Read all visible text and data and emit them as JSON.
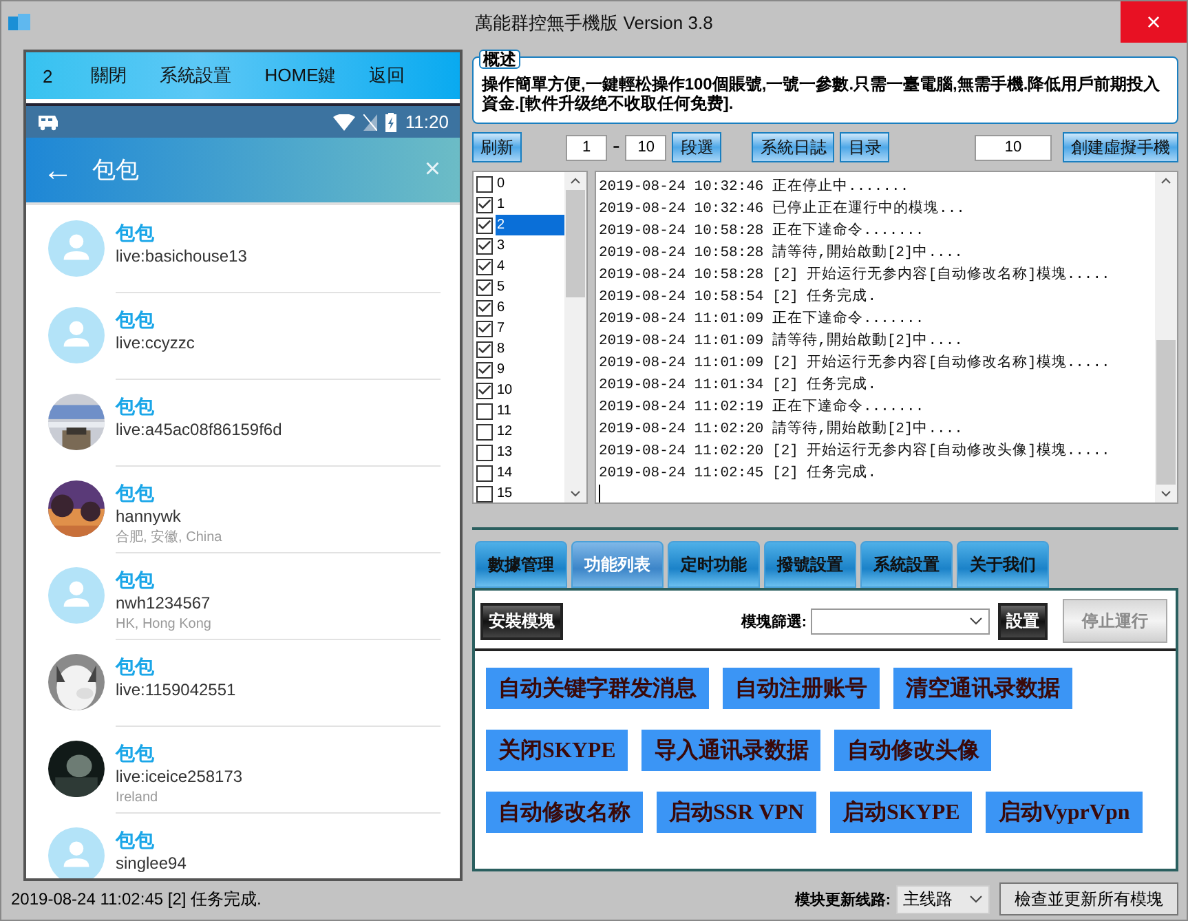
{
  "window": {
    "title": "萬能群控無手機版 Version 3.8",
    "close": "×"
  },
  "phone": {
    "toolbar": [
      "2",
      "關閉",
      "系統設置",
      "HOME鍵",
      "返回"
    ],
    "status_time": "11:20",
    "search": {
      "back": "←",
      "value": "包包",
      "clear": "×"
    },
    "contacts": [
      {
        "name": "包包",
        "id": "live:basichouse13",
        "kind": "default"
      },
      {
        "name": "包包",
        "id": "live:ccyzzc",
        "kind": "default"
      },
      {
        "name": "包包",
        "id": "live:a45ac08f86159f6d",
        "kind": "picture"
      },
      {
        "name": "包包",
        "id": "hannywk",
        "location": "合肥, 安徽, China",
        "kind": "picture"
      },
      {
        "name": "包包",
        "id": "nwh1234567",
        "location": "HK, Hong Kong",
        "kind": "default"
      },
      {
        "name": "包包",
        "id": "live:1159042551",
        "kind": "picture"
      },
      {
        "name": "包包",
        "id": "live:iceice258173",
        "location": "Ireland",
        "kind": "picture"
      },
      {
        "name": "包包",
        "id": "singlee94",
        "kind": "default"
      }
    ]
  },
  "overview": {
    "legend": "概述",
    "text": "操作簡單方便,一鍵輕松操作100個賬號,一號一參數.只需一臺電腦,無需手機.降低用戶前期投入資金.[軟件升级绝不收取任何免费]."
  },
  "toolbar": {
    "refresh": "刷新",
    "range_from": "1",
    "range_sep": "-",
    "range_to": "10",
    "select": "段選",
    "log": "系統日誌",
    "catalog": "目录",
    "count": "10",
    "create": "創建虛擬手機"
  },
  "devices": [
    {
      "label": "0",
      "checked": false,
      "selected": false
    },
    {
      "label": "1",
      "checked": true,
      "selected": false
    },
    {
      "label": "2",
      "checked": true,
      "selected": true
    },
    {
      "label": "3",
      "checked": true,
      "selected": false
    },
    {
      "label": "4",
      "checked": true,
      "selected": false
    },
    {
      "label": "5",
      "checked": true,
      "selected": false
    },
    {
      "label": "6",
      "checked": true,
      "selected": false
    },
    {
      "label": "7",
      "checked": true,
      "selected": false
    },
    {
      "label": "8",
      "checked": true,
      "selected": false
    },
    {
      "label": "9",
      "checked": true,
      "selected": false
    },
    {
      "label": "10",
      "checked": true,
      "selected": false
    },
    {
      "label": "11",
      "checked": false,
      "selected": false
    },
    {
      "label": "12",
      "checked": false,
      "selected": false
    },
    {
      "label": "13",
      "checked": false,
      "selected": false
    },
    {
      "label": "14",
      "checked": false,
      "selected": false
    },
    {
      "label": "15",
      "checked": false,
      "selected": false
    }
  ],
  "log": [
    "2019-08-24 10:32:46 正在停止中.......",
    "2019-08-24 10:32:46 已停止正在運行中的模塊...",
    "2019-08-24 10:58:28 正在下達命令.......",
    "2019-08-24 10:58:28 請等待,開始啟動[2]中....",
    "2019-08-24 10:58:28 [2] 开始运行无参内容[自动修改名称]模塊.....",
    "2019-08-24 10:58:54 [2] 任务完成.",
    "2019-08-24 11:01:09 正在下達命令.......",
    "2019-08-24 11:01:09 請等待,開始啟動[2]中....",
    "2019-08-24 11:01:09 [2] 开始运行无参内容[自动修改名称]模塊.....",
    "2019-08-24 11:01:34 [2] 任务完成.",
    "2019-08-24 11:02:19 正在下達命令.......",
    "2019-08-24 11:02:20 請等待,開始啟動[2]中....",
    "2019-08-24 11:02:20 [2] 开始运行无参内容[自动修改头像]模塊.....",
    "2019-08-24 11:02:45 [2] 任务完成."
  ],
  "tabs": [
    {
      "label": "數據管理",
      "selected": false
    },
    {
      "label": "功能列表",
      "selected": true
    },
    {
      "label": "定时功能",
      "selected": false
    },
    {
      "label": "撥號設置",
      "selected": false
    },
    {
      "label": "系統設置",
      "selected": false
    },
    {
      "label": "关于我们",
      "selected": false
    }
  ],
  "panel": {
    "install": "安裝模塊",
    "filter_label": "模塊篩選:",
    "settings": "設置",
    "stop": "停止運行",
    "stop_disabled": true,
    "functions": [
      [
        "自动关键字群发消息",
        "自动注册账号",
        "清空通讯录数据"
      ],
      [
        "关闭SKYPE",
        "导入通讯录数据",
        "自动修改头像"
      ],
      [
        "自动修改名称",
        "启动SSR VPN",
        "启动SKYPE",
        "启动VyprVpn"
      ]
    ]
  },
  "status_bar": {
    "message": "2019-08-24 11:02:45 [2] 任务完成.",
    "route_label": "模块更新线路:",
    "route": "主线路",
    "update": "檢查並更新所有模塊"
  }
}
